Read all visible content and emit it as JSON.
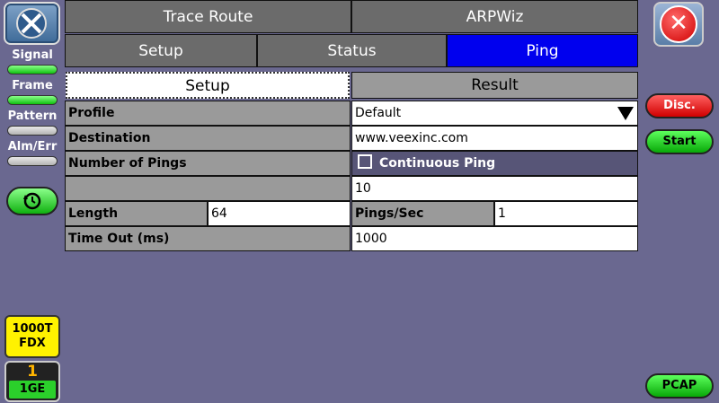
{
  "sidebar": {
    "signal_label": "Signal",
    "frame_label": "Frame",
    "pattern_label": "Pattern",
    "almerr_label": "Alm/Err",
    "port_line1": "1000T",
    "port_line2": "FDX",
    "port_number": "1",
    "port_speed": "1GE"
  },
  "right_panel": {
    "disc_label": "Disc.",
    "start_label": "Start",
    "pcap_label": "PCAP"
  },
  "tabs": {
    "top": [
      "Trace Route",
      "ARPWiz"
    ],
    "main": [
      "Setup",
      "Status",
      "Ping"
    ],
    "sub": [
      "Setup",
      "Result"
    ]
  },
  "form": {
    "profile_label": "Profile",
    "profile_value": "Default",
    "destination_label": "Destination",
    "destination_value": "www.veexinc.com",
    "pings_label": "Number of Pings",
    "continuous_label": "Continuous Ping",
    "pings_value": "10",
    "length_label": "Length",
    "length_value": "64",
    "pps_label": "Pings/Sec",
    "pps_value": "1",
    "timeout_label": "Time Out (ms)",
    "timeout_value": "1000"
  },
  "colors": {
    "background": "#6a6890",
    "active_tab": "#0000ee",
    "disc_button": "#d00000",
    "start_button": "#08a808",
    "port_badge": "#fff200"
  }
}
